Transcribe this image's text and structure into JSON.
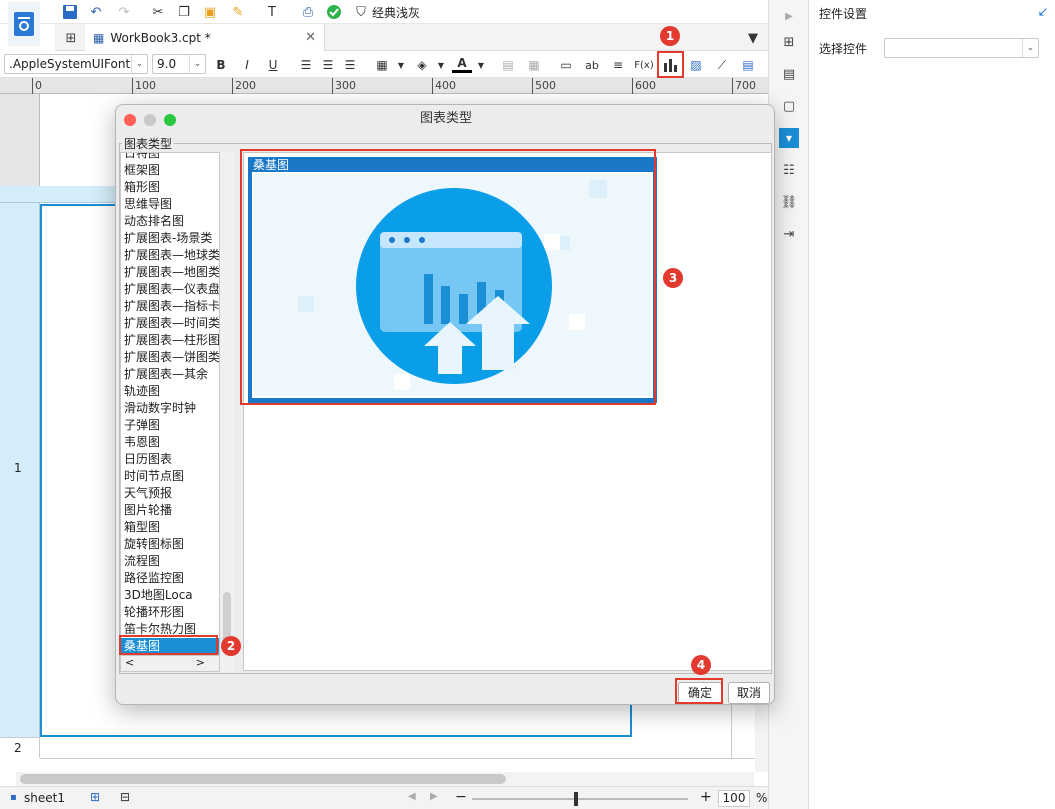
{
  "toolbar": {
    "theme_label": "经典浅灰"
  },
  "tab": {
    "label": "WorkBook3.cpt *"
  },
  "format_bar": {
    "font_name": ".AppleSystemUIFont",
    "font_size": "9.0",
    "bold": "B",
    "italic": "I",
    "underline": "U",
    "abc_label": "ab",
    "fx_label": "F(x)"
  },
  "ruler": {
    "ticks": [
      "0",
      "100",
      "200",
      "300",
      "400",
      "500",
      "600",
      "700"
    ]
  },
  "grid": {
    "row1": "1",
    "row2": "2"
  },
  "dialog": {
    "title": "图表类型",
    "group_label": "图表类型",
    "list_items": [
      "日特图",
      "框架图",
      "箱形图",
      "思维导图",
      "动态排名图",
      "扩展图表-场景类",
      "扩展图表—地球类",
      "扩展图表—地图类",
      "扩展图表—仪表盘",
      "扩展图表—指标卡",
      "扩展图表—时间类",
      "扩展图表—柱形图",
      "扩展图表—饼图类",
      "扩展图表—其余",
      "轨迹图",
      "滑动数字时钟",
      "子弹图",
      "韦恩图",
      "日历图表",
      "时间节点图",
      "天气预报",
      "图片轮播",
      "箱型图",
      "旋转图标图",
      "流程图",
      "路径监控图",
      "3D地图Loca",
      "轮播环形图",
      "笛卡尔热力图",
      "桑基图"
    ],
    "selected_index": 29,
    "preview_label": "桑基图",
    "ok_label": "确定",
    "cancel_label": "取消"
  },
  "badges": [
    "1",
    "2",
    "3",
    "4"
  ],
  "right_panel": {
    "title": "控件设置",
    "select_label": "选择控件",
    "select_value": ""
  },
  "status": {
    "sheet_tab": "sheet1",
    "zoom_value": "100",
    "zoom_unit": "%"
  },
  "colors": {
    "accent": "#1a8fd6",
    "highlight": "#e23a2e",
    "selection": "#1a8fd6"
  }
}
